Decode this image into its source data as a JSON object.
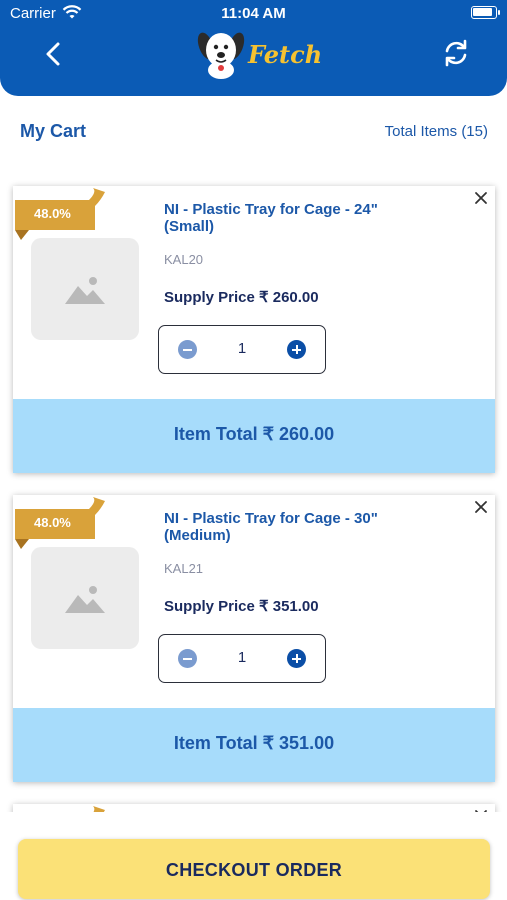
{
  "status_bar": {
    "carrier": "Carrier",
    "time": "11:04 AM"
  },
  "header": {
    "logo_text": "Fetch",
    "back_icon": "chevron-left-icon",
    "refresh_icon": "refresh-icon"
  },
  "cart": {
    "title": "My Cart",
    "total_items": "Total Items (15)"
  },
  "items": [
    {
      "discount": "48.0%",
      "name": "NI - Plastic Tray for Cage - 24\" (Small)",
      "code": "KAL20",
      "supply_price": "Supply Price ₹ 260.00",
      "quantity": "1",
      "item_total": "Item Total ₹ 260.00"
    },
    {
      "discount": "48.0%",
      "name": "NI - Plastic Tray for Cage - 30\" (Medium)",
      "code": "KAL21",
      "supply_price": "Supply Price ₹ 351.00",
      "quantity": "1",
      "item_total": "Item Total ₹ 351.00"
    }
  ],
  "footer": {
    "checkout_label": "CHECKOUT ORDER"
  },
  "colors": {
    "brand_blue": "#0b5bb5",
    "total_bar": "#a7dcfb",
    "checkout": "#fbe177",
    "ribbon": "#d9a23a"
  }
}
